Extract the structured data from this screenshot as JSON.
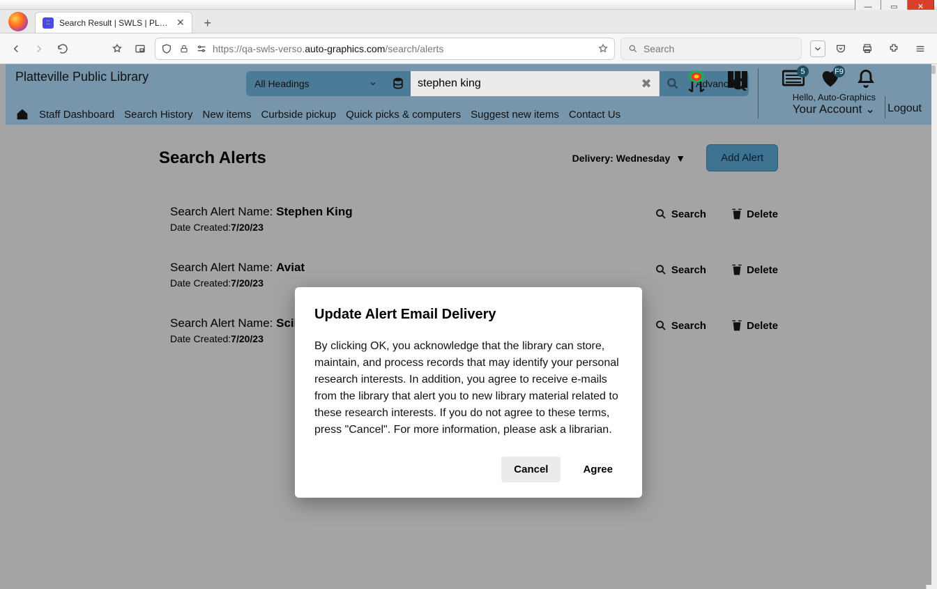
{
  "window": {
    "tab_title": "Search Result | SWLS | PLATT | A"
  },
  "browser": {
    "url_prefix": "https://",
    "url_sub": "qa-swls-verso.",
    "url_domain": "auto-graphics.com",
    "url_path": "/search/alerts",
    "search_placeholder": "Search"
  },
  "library": {
    "name": "Platteville Public Library",
    "heading_select": "All Headings",
    "search_value": "stephen king",
    "advanced": "Advanced",
    "greeting": "Hello, Auto-Graphics",
    "your_account": "Your Account",
    "logout": "Logout",
    "badges": {
      "card": "5",
      "heart": "F9"
    },
    "nav": {
      "staff": "Staff Dashboard",
      "history": "Search History",
      "new_items": "New items",
      "curbside": "Curbside pickup",
      "quick": "Quick picks & computers",
      "suggest": "Suggest new items",
      "contact": "Contact Us"
    }
  },
  "content": {
    "title": "Search Alerts",
    "delivery_label": "Delivery: Wednesday",
    "add_alert": "Add Alert",
    "alert_name_prefix": "Search Alert Name: ",
    "date_prefix": "Date Created:",
    "search_label": "Search",
    "delete_label": "Delete",
    "alerts": [
      {
        "name": "Stephen King",
        "date": "7/20/23"
      },
      {
        "name": "Aviat",
        "date": "7/20/23"
      },
      {
        "name": "SciFi",
        "date": "7/20/23"
      }
    ]
  },
  "modal": {
    "title": "Update Alert Email Delivery",
    "body": "By clicking OK, you acknowledge that the library can store, maintain, and process records that may identify your personal research interests. In addition, you agree to receive e-mails from the library that alert you to new library material related to these research interests. If you do not agree to these terms, press \"Cancel\". For more information, please ask a librarian.",
    "cancel": "Cancel",
    "agree": "Agree"
  }
}
